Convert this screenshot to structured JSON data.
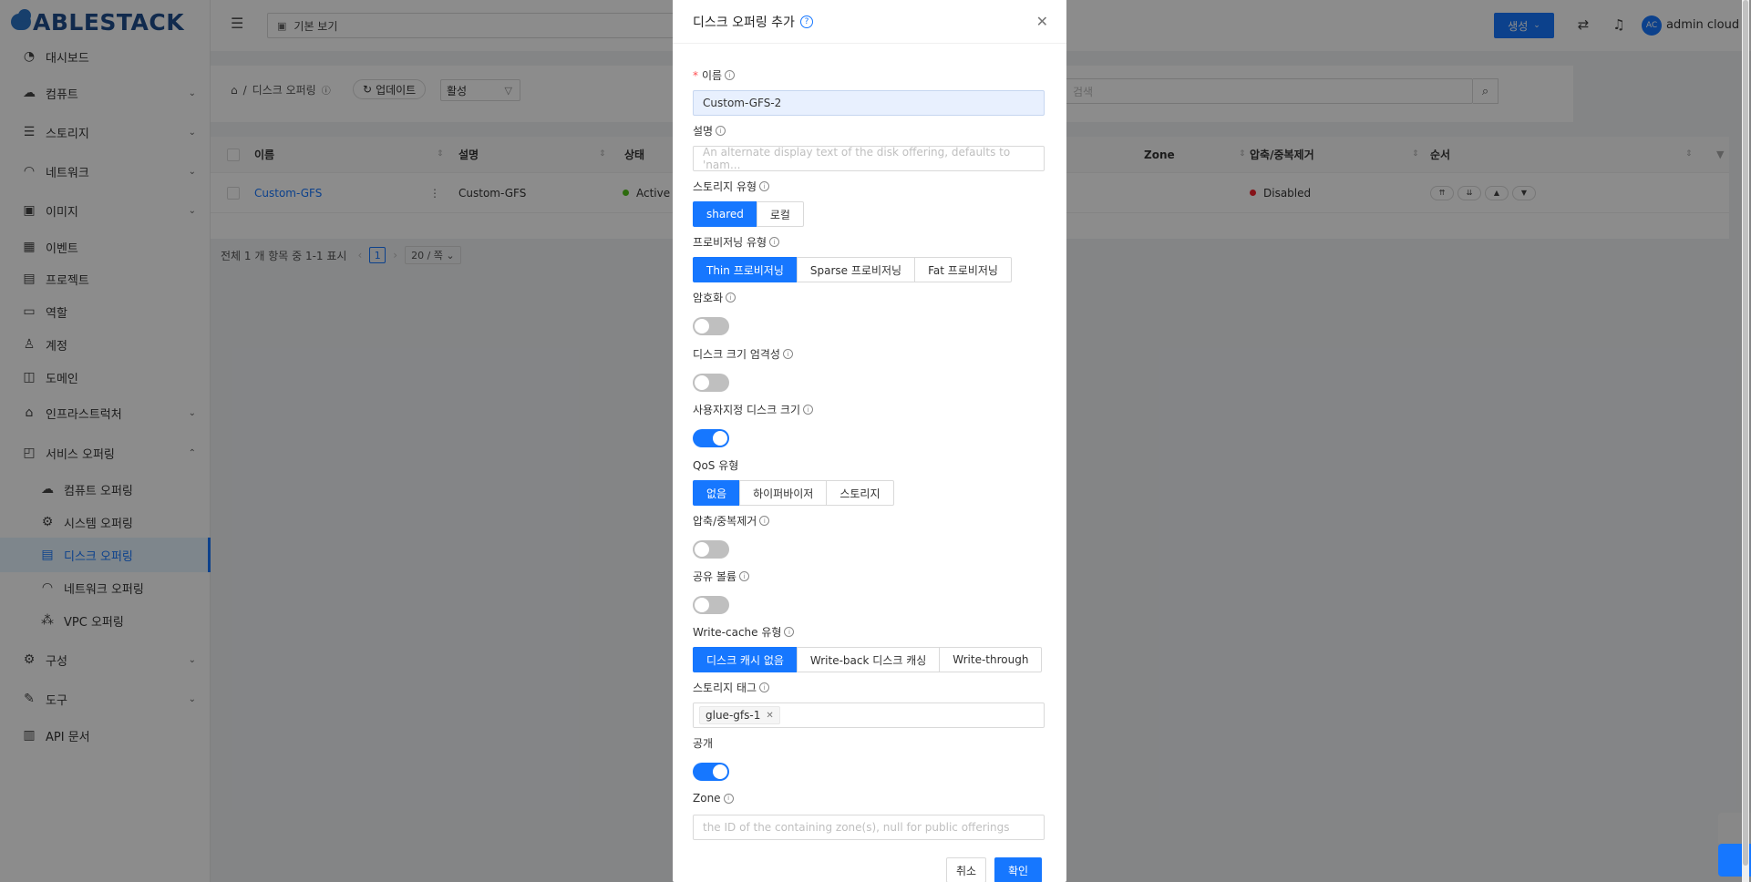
{
  "brand": {
    "logo_text": "ABLESTACK"
  },
  "sidebar": {
    "items": [
      {
        "label": "대시보드",
        "icon": "dashboard-icon"
      },
      {
        "label": "컴퓨트",
        "icon": "cloud-icon"
      },
      {
        "label": "스토리지",
        "icon": "database-icon"
      },
      {
        "label": "네트워크",
        "icon": "wifi-icon"
      },
      {
        "label": "이미지",
        "icon": "image-icon"
      },
      {
        "label": "이벤트",
        "icon": "calendar-icon"
      },
      {
        "label": "프로젝트",
        "icon": "project-icon"
      },
      {
        "label": "역할",
        "icon": "idcard-icon"
      },
      {
        "label": "계정",
        "icon": "user-icon"
      },
      {
        "label": "도메인",
        "icon": "block-icon"
      },
      {
        "label": "인프라스트럭처",
        "icon": "bank-icon"
      },
      {
        "label": "서비스 오퍼링",
        "icon": "shopping-icon"
      },
      {
        "label": "컴퓨트 오퍼링",
        "icon": "cloud-icon"
      },
      {
        "label": "시스템 오퍼링",
        "icon": "setting-icon"
      },
      {
        "label": "디스크 오퍼링",
        "icon": "hdd-icon"
      },
      {
        "label": "네트워크 오퍼링",
        "icon": "wifi-icon"
      },
      {
        "label": "VPC 오퍼링",
        "icon": "deployment-unit-icon"
      },
      {
        "label": "구성",
        "icon": "setting-icon"
      },
      {
        "label": "도구",
        "icon": "tool-icon"
      },
      {
        "label": "API 문서",
        "icon": "read-icon"
      }
    ]
  },
  "header": {
    "view_select": "기본 보기",
    "create_label": "생성",
    "avatar_initials": "AC",
    "user_name": "admin cloud"
  },
  "toolbar": {
    "breadcrumb_current": "디스크 오퍼링",
    "refresh_label": "업데이트",
    "filter_value": "활성",
    "search_placeholder": "검색"
  },
  "table": {
    "columns": [
      "이름",
      "설명",
      "상태",
      "Zone",
      "압축/중복제거",
      "순서"
    ],
    "rows": [
      {
        "name": "Custom-GFS",
        "description": "Custom-GFS",
        "state": "Active",
        "dedup": "Disabled"
      }
    ]
  },
  "pagination": {
    "summary": "전체 1 개 항목 중 1-1 표시",
    "current_page": "1",
    "page_size": "20 / 쪽"
  },
  "modal": {
    "title": "디스크 오퍼링 추가",
    "name_label": "이름",
    "name_value": "Custom-GFS-2",
    "desc_label": "설명",
    "desc_placeholder": "An alternate display text of the disk offering, defaults to 'nam...",
    "storage_type_label": "스토리지 유형",
    "storage_type_options": [
      "shared",
      "로컬"
    ],
    "storage_type_selected": "shared",
    "provisioning_label": "프로비저닝 유형",
    "provisioning_options": [
      "Thin 프로비저닝",
      "Sparse 프로비저닝",
      "Fat 프로비저닝"
    ],
    "provisioning_selected": "Thin 프로비저닝",
    "encryption_label": "암호화",
    "encryption_on": false,
    "disk_strict_label": "디스크 크기 엄격성",
    "disk_strict_on": false,
    "custom_size_label": "사용자지정 디스크 크기",
    "custom_size_on": true,
    "qos_label": "QoS 유형",
    "qos_options": [
      "없음",
      "하이퍼바이저",
      "스토리지"
    ],
    "qos_selected": "없음",
    "dedup_label": "압축/중복제거",
    "dedup_on": false,
    "shared_vol_label": "공유 볼륨",
    "shared_vol_on": false,
    "write_cache_label": "Write-cache 유형",
    "write_cache_options": [
      "디스크 캐시 없음",
      "Write-back 디스크 캐싱",
      "Write-through"
    ],
    "write_cache_selected": "디스크 캐시 없음",
    "storage_tags_label": "스토리지 태그",
    "storage_tag_value": "glue-gfs-1",
    "public_label": "공개",
    "public_on": true,
    "zone_label": "Zone",
    "zone_placeholder": "the ID of the containing zone(s), null for public offerings",
    "cancel_label": "취소",
    "ok_label": "확인"
  },
  "colors": {
    "accent": "#1677ff",
    "active_dot": "#52c41a",
    "disabled_dot": "#f5222d"
  }
}
